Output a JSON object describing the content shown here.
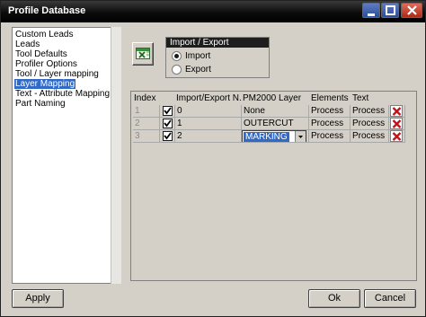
{
  "window": {
    "title": "Profile Database"
  },
  "tree": {
    "items": [
      {
        "label": "Custom Leads",
        "selected": false
      },
      {
        "label": "Leads",
        "selected": false
      },
      {
        "label": "Tool Defaults",
        "selected": false
      },
      {
        "label": "Profiler Options",
        "selected": false
      },
      {
        "label": "Tool / Layer mapping",
        "selected": false
      },
      {
        "label": "Layer Mapping",
        "selected": true
      },
      {
        "label": "Text - Attribute Mapping",
        "selected": false
      },
      {
        "label": "Part Naming",
        "selected": false
      }
    ]
  },
  "import_export": {
    "title": "Import / Export",
    "options": [
      {
        "label": "Import",
        "checked": true
      },
      {
        "label": "Export",
        "checked": false
      }
    ],
    "icon": "spreadsheet-icon"
  },
  "grid": {
    "columns": [
      "Index",
      "Import/Export N...",
      "PM2000 Layer",
      "Elements",
      "Text"
    ],
    "rows": [
      {
        "index": "1",
        "enabled": true,
        "import_name": "0",
        "layer": "None",
        "elements": "Process",
        "text": "Process"
      },
      {
        "index": "2",
        "enabled": true,
        "import_name": "1",
        "layer": "OUTERCUT",
        "elements": "Process",
        "text": "Process"
      },
      {
        "index": "3",
        "enabled": true,
        "import_name": "2",
        "layer": "MARKING",
        "elements": "Process",
        "text": "Process",
        "editing": true
      }
    ]
  },
  "buttons": {
    "apply": "Apply",
    "ok": "Ok",
    "cancel": "Cancel"
  },
  "colors": {
    "selection": "#3169c6",
    "delete_icon": "#c0141b"
  }
}
